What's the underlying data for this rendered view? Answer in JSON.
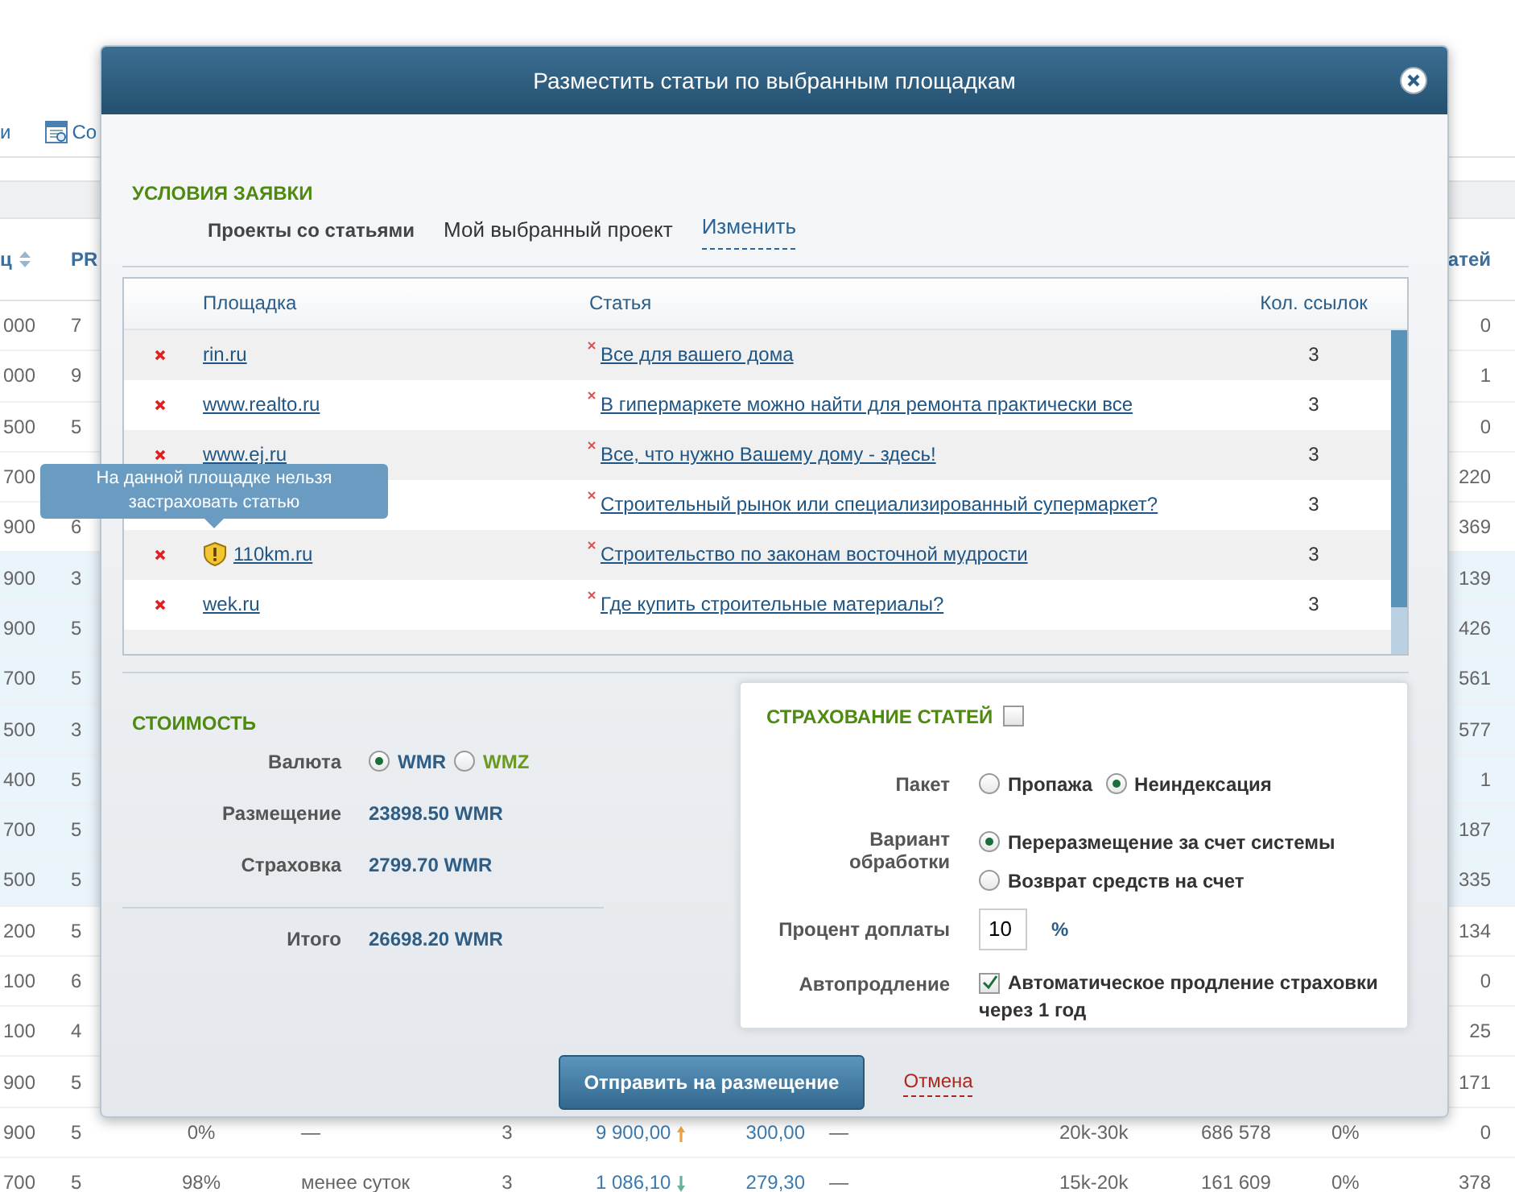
{
  "background": {
    "toolbar": [
      {
        "label": "и",
        "kind": "text"
      },
      {
        "label": "Со",
        "kind": "icon_text"
      }
    ],
    "columns": [
      "ц",
      "PR",
      "атей"
    ],
    "rows": [
      {
        "column_1": "000",
        "column_2": "7",
        "column_3": "0",
        "highlighted": false
      },
      {
        "column_1": "000",
        "column_2": "9",
        "column_3": "1",
        "highlighted": false
      },
      {
        "column_1": "500",
        "column_2": "5",
        "column_3": "0",
        "highlighted": false
      },
      {
        "column_1": "700",
        "column_3": "220",
        "highlighted": false
      },
      {
        "column_1": "900",
        "column_2": "6",
        "column_3": "369",
        "highlighted": false
      },
      {
        "column_1": "900",
        "column_2": "3",
        "column_3": "139",
        "highlighted": true
      },
      {
        "column_1": "900",
        "column_2": "5",
        "column_3": "426",
        "highlighted": true
      },
      {
        "column_1": "700",
        "column_2": "5",
        "column_3": "561",
        "highlighted": true
      },
      {
        "column_1": "500",
        "column_2": "3",
        "column_3": "577",
        "highlighted": true
      },
      {
        "column_1": "400",
        "column_2": "5",
        "column_3": "1",
        "highlighted": true
      },
      {
        "column_1": "700",
        "column_2": "5",
        "column_3": "187",
        "highlighted": true
      },
      {
        "column_1": "500",
        "column_2": "5",
        "column_3": "335",
        "highlighted": true
      },
      {
        "column_1": "200",
        "column_2": "5",
        "column_3": "134",
        "highlighted": false
      },
      {
        "column_1": "100",
        "column_2": "6",
        "column_3": "0",
        "highlighted": false
      },
      {
        "column_1": "100",
        "column_2": "4",
        "column_3": "25",
        "highlighted": false
      },
      {
        "column_1": "900",
        "column_2": "5",
        "column_3": "171",
        "highlighted": false
      }
    ],
    "full_rows": [
      {
        "cells": [
          "900",
          "5",
          "0%",
          "—",
          "3",
          "9 900,00",
          "300,00",
          "—",
          "20k-30k",
          "686 578",
          "0%",
          "0"
        ],
        "rising": true
      },
      {
        "cells": [
          "700",
          "5",
          "98%",
          "менее суток",
          "3",
          "1 086,10",
          "279,30",
          "—",
          "15k-20k",
          "161 609",
          "0%",
          "378"
        ],
        "rising": false
      }
    ]
  },
  "dialog": {
    "title": "Разместить статьи по выбранным площадкам",
    "conditions": {
      "heading": "УСЛОВИЯ ЗАЯВКИ",
      "label": "Проекты со статьями",
      "value": "Мой выбранный проект",
      "change_link": "Изменить"
    },
    "table": {
      "columns": [
        "Площадка",
        "Статья",
        "Кол. ссылок"
      ],
      "rows": [
        {
          "kind": "normal",
          "site": "rin.ru",
          "article": "Все для вашего дома",
          "links": "3"
        },
        {
          "kind": "normal",
          "site": "www.realto.ru",
          "article": "В гипермаркете можно найти для ремонта практически все",
          "links": "3"
        },
        {
          "kind": "normal",
          "site": "www.ej.ru",
          "article": "Все, что нужно Вашему дому - здесь!",
          "links": "3"
        },
        {
          "kind": "obscured",
          "article": "Строительный рынок или специализированный супермаркет?",
          "links": "3"
        },
        {
          "kind": "warning",
          "site": "110km.ru",
          "article": "Строительство по законам восточной мудрости",
          "links": "3"
        },
        {
          "kind": "normal",
          "site": "wek.ru",
          "article": "Где купить строительные материалы?",
          "links": "3"
        }
      ]
    },
    "tooltip": "На данной площадке нельзя застраховать статью",
    "cost": {
      "heading": "СТОИМОСТЬ",
      "currency_label": "Валюта",
      "currencies": [
        {
          "label": "WMR",
          "selected": true
        },
        {
          "label": "WMZ",
          "selected": false
        }
      ],
      "lines": [
        {
          "label": "Размещение",
          "value": "23898.50 WMR"
        },
        {
          "label": "Страховка",
          "value": "2799.70 WMR"
        }
      ],
      "total": {
        "label": "Итого",
        "value": "26698.20 WMR"
      }
    },
    "insurance": {
      "heading": "СТРАХОВАНИЕ СТАТЕЙ",
      "checked": false,
      "package": {
        "label": "Пакет",
        "options": [
          {
            "label": "Пропажа",
            "selected": false
          },
          {
            "label": "Неиндексация",
            "selected": true
          }
        ]
      },
      "handling": {
        "label": "Вариант обработки",
        "options": [
          {
            "label": "Переразмещение за счет системы",
            "selected": true
          },
          {
            "label": "Возврат средств на счет",
            "selected": false
          }
        ]
      },
      "surcharge": {
        "label": "Процент доплаты",
        "value": "10",
        "unit": "%"
      },
      "autorenew": {
        "label": "Автопродление",
        "checked": true,
        "text": "Автоматическое продление страховки через 1 год"
      }
    },
    "buttons": {
      "submit": "Отправить на размещение",
      "cancel": "Отмена"
    }
  }
}
